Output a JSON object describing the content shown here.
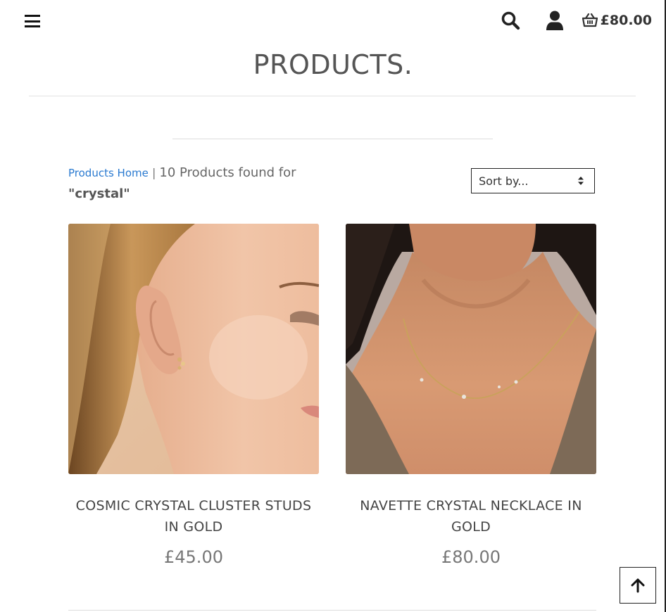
{
  "header": {
    "basket_total": "£80.00"
  },
  "page_title": "PRODUCTS.",
  "results": {
    "home_link": "Products Home",
    "separator": "|",
    "count_text": "10 Products found for",
    "query": "\"crystal\""
  },
  "sort": {
    "selected": "Sort by..."
  },
  "products": [
    {
      "name": "COSMIC CRYSTAL CLUSTER STUDS IN GOLD",
      "price": "£45.00"
    },
    {
      "name": "NAVETTE CRYSTAL NECKLACE IN GOLD",
      "price": "£80.00"
    }
  ],
  "icons": {
    "menu": "hamburger-menu-icon",
    "search": "search-icon",
    "account": "user-icon",
    "basket": "basket-icon",
    "sort": "sort-arrows-icon",
    "back_to_top": "arrow-up-icon"
  },
  "colors": {
    "link": "#2a7ad0",
    "text": "#555555",
    "dark": "#111111"
  }
}
